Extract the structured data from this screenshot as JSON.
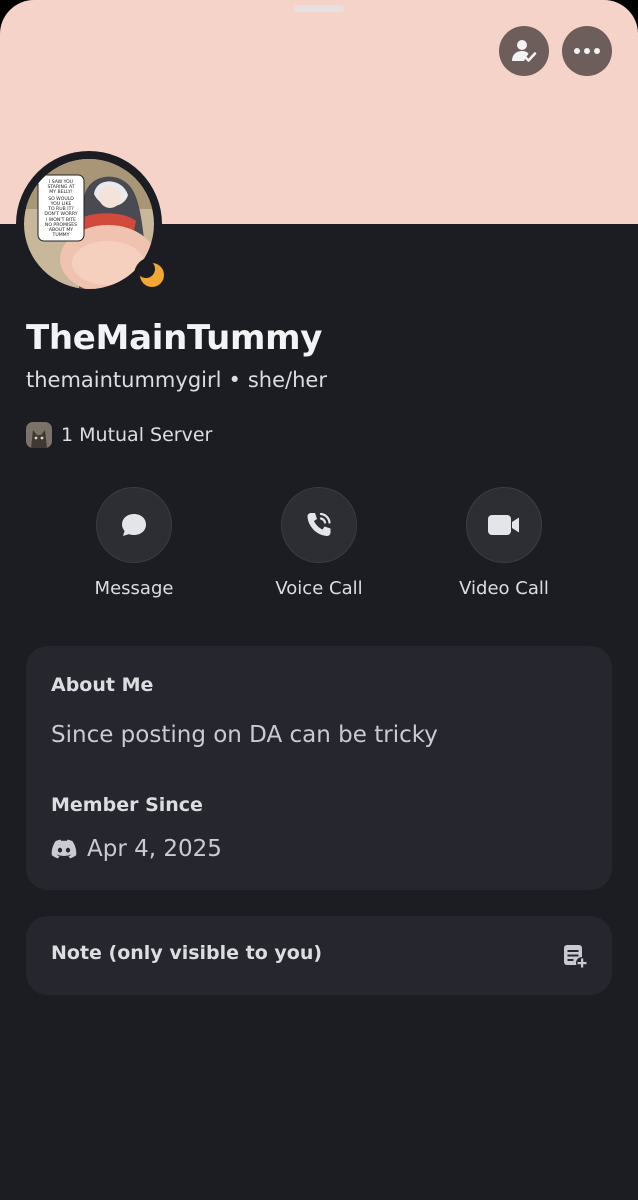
{
  "profile": {
    "display_name": "TheMainTummy",
    "username": "themaintummygirl",
    "separator": "•",
    "pronouns": "she/her",
    "mutual_servers": "1 Mutual Server",
    "banner_color": "#f6d3c8",
    "status": "idle"
  },
  "header": {
    "friend_button_icon": "person-check-icon",
    "more_button_icon": "more-horizontal-icon"
  },
  "actions": [
    {
      "label": "Message",
      "icon": "chat-bubble-icon"
    },
    {
      "label": "Voice Call",
      "icon": "phone-icon"
    },
    {
      "label": "Video Call",
      "icon": "video-camera-icon"
    }
  ],
  "about": {
    "heading": "About Me",
    "text": "Since posting on DA can be tricky",
    "member_since_heading": "Member Since",
    "member_since_date": "Apr 4, 2025"
  },
  "note": {
    "label": "Note (only visible to you)",
    "icon": "note-add-icon"
  },
  "avatar": {
    "speech_lines": [
      "I SAW YOU",
      "STARING AT",
      "MY BELLY!",
      "SO WOULD",
      "YOU LIKE",
      "TO RUB IT?",
      "DON'T WORRY",
      "I WON'T BITE",
      "NO PROMISES",
      "ABOUT MY",
      "TUMMY"
    ]
  }
}
